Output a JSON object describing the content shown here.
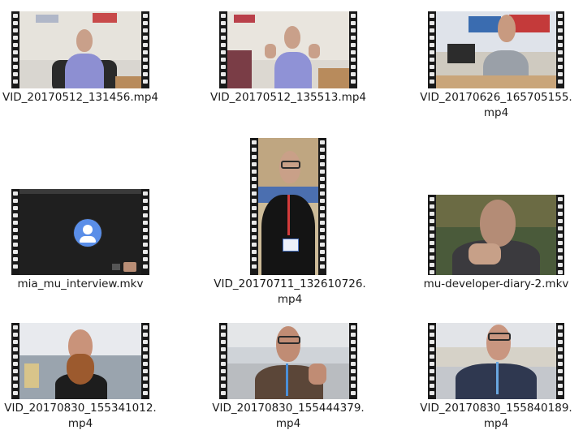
{
  "files": [
    {
      "label_lines": [
        "VID_20170512_131456.mp4"
      ],
      "kind": "video",
      "thumb_icon": "video-thumbnail"
    },
    {
      "label_lines": [
        "VID_20170512_135513.mp4"
      ],
      "kind": "video",
      "thumb_icon": "video-thumbnail"
    },
    {
      "label_lines": [
        "VID_20170626_165705155.",
        "mp4"
      ],
      "kind": "video",
      "thumb_icon": "video-thumbnail"
    },
    {
      "label_lines": [
        "mia_mu_interview.mkv"
      ],
      "kind": "video",
      "thumb_icon": "person-avatar-icon"
    },
    {
      "label_lines": [
        "VID_20170711_132610726.",
        "mp4"
      ],
      "kind": "video",
      "thumb_icon": "video-thumbnail"
    },
    {
      "label_lines": [
        "mu-developer-diary-2.mkv"
      ],
      "kind": "video",
      "thumb_icon": "video-thumbnail"
    },
    {
      "label_lines": [
        "VID_20170830_155341012.",
        "mp4"
      ],
      "kind": "video",
      "thumb_icon": "video-thumbnail"
    },
    {
      "label_lines": [
        "VID_20170830_155444379.",
        "mp4"
      ],
      "kind": "video",
      "thumb_icon": "video-thumbnail"
    },
    {
      "label_lines": [
        "VID_20170830_155840189.",
        "mp4"
      ],
      "kind": "video",
      "thumb_icon": "video-thumbnail"
    }
  ],
  "colors": {
    "filmstrip": "#1a1a1a",
    "sprocket": "#e9e9e9",
    "label_text": "#1a1a1a",
    "background": "#ffffff"
  }
}
